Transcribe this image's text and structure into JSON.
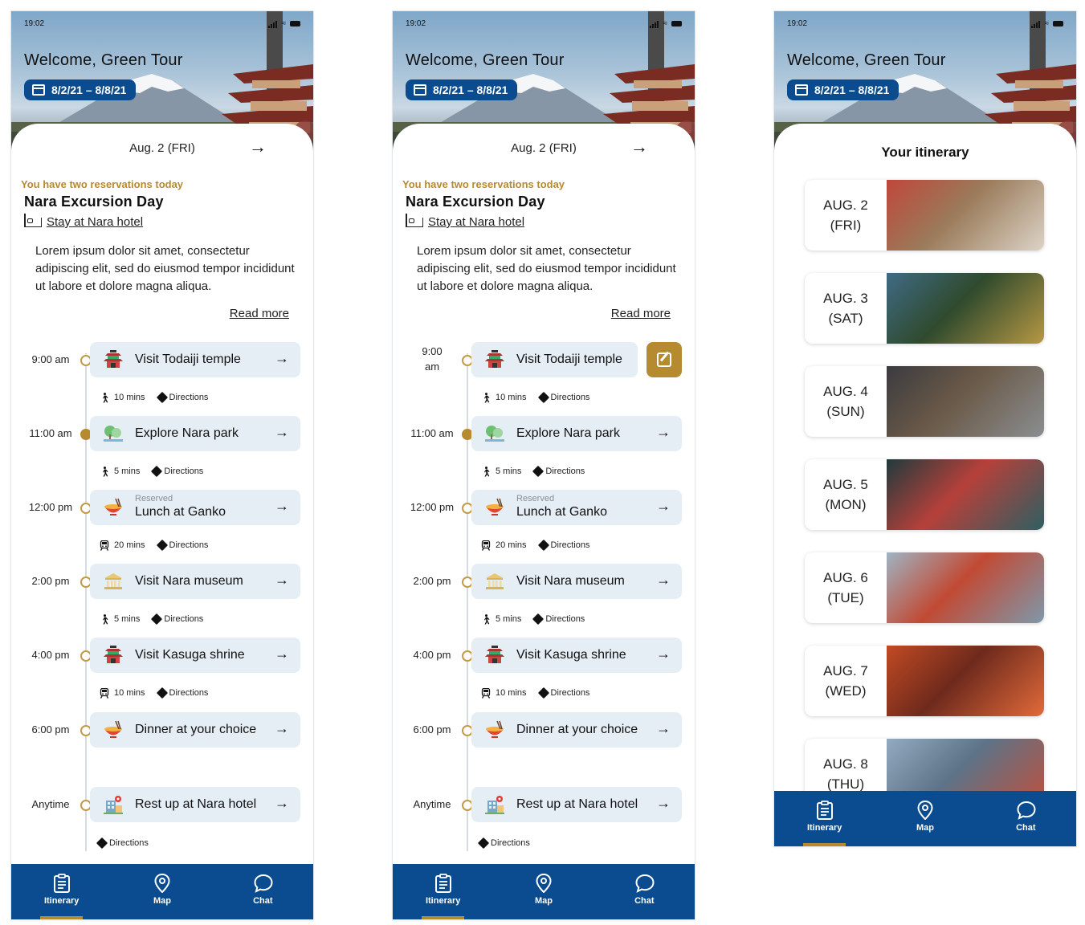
{
  "status": {
    "time": "19:02"
  },
  "header": {
    "welcome": "Welcome, Green Tour",
    "date_range": "8/2/21 – 8/8/21"
  },
  "day": {
    "label": "Aug. 2 (FRI)",
    "arrow": "→",
    "reservations_note": "You have two reservations today",
    "title": "Nara Excursion Day",
    "stay": "Stay at Nara hotel",
    "description": "Lorem ipsum dolor sit amet, consectetur adipiscing elit, sed do eiusmod tempor incididunt ut labore et dolore magna aliqua.",
    "read_more": "Read more"
  },
  "events": [
    {
      "time": "9:00 am",
      "time_alt": "9:00\nam",
      "label": "Visit Todaiji temple",
      "icon": "temple-icon",
      "current": false
    },
    {
      "time": "11:00 am",
      "label": "Explore Nara park",
      "icon": "park-icon",
      "current": true
    },
    {
      "time": "12:00 pm",
      "label": "Lunch at Ganko",
      "sublabel": "Reserved",
      "icon": "ramen-icon",
      "current": false
    },
    {
      "time": "2:00 pm",
      "label": "Visit Nara museum",
      "icon": "museum-icon",
      "current": false
    },
    {
      "time": "4:00 pm",
      "label": "Visit Kasuga shrine",
      "icon": "temple-icon",
      "current": false
    },
    {
      "time": "6:00 pm",
      "label": "Dinner at your choice",
      "icon": "ramen-icon",
      "current": false
    },
    {
      "time": "Anytime",
      "label": "Rest up at Nara hotel",
      "icon": "hotel-icon",
      "current": false
    }
  ],
  "travel": [
    {
      "mode": "walk-icon",
      "duration": "10 mins",
      "directions": "Directions"
    },
    {
      "mode": "walk-icon",
      "duration": "5 mins",
      "directions": "Directions"
    },
    {
      "mode": "train-icon",
      "duration": "20 mins",
      "directions": "Directions"
    },
    {
      "mode": "walk-icon",
      "duration": "5 mins",
      "directions": "Directions"
    },
    {
      "mode": "train-icon",
      "duration": "10 mins",
      "directions": "Directions"
    },
    {
      "mode": "none",
      "duration": "",
      "directions": ""
    },
    {
      "mode": "none",
      "duration": "",
      "directions": "Directions"
    }
  ],
  "tabs": [
    {
      "label": "Itinerary",
      "icon": "clipboard-icon",
      "active": true
    },
    {
      "label": "Map",
      "icon": "map-pin-icon",
      "active": false
    },
    {
      "label": "Chat",
      "icon": "chat-bubble-icon",
      "active": false
    }
  ],
  "itinerary": {
    "title": "Your itinerary",
    "days": [
      {
        "date": "AUG. 2",
        "weekday": "(FRI)",
        "photo": "autumn-shrine-photo",
        "colors": [
          "#c0473a",
          "#9a7b5a",
          "#dcd3c6"
        ]
      },
      {
        "date": "AUG. 3",
        "weekday": "(SAT)",
        "photo": "golden-pavilion-photo",
        "colors": [
          "#3f6b85",
          "#2f4a2d",
          "#b79844"
        ]
      },
      {
        "date": "AUG. 4",
        "weekday": "(SUN)",
        "photo": "old-street-photo",
        "colors": [
          "#3a3b3f",
          "#6b5a48",
          "#8a8e90"
        ]
      },
      {
        "date": "AUG. 5",
        "weekday": "(MON)",
        "photo": "night-alley-photo",
        "colors": [
          "#203a3c",
          "#b6403a",
          "#2e5f62"
        ]
      },
      {
        "date": "AUG. 6",
        "weekday": "(TUE)",
        "photo": "floating-torii-photo",
        "colors": [
          "#9fb4c3",
          "#c14a34",
          "#7f98aa"
        ]
      },
      {
        "date": "AUG. 7",
        "weekday": "(WED)",
        "photo": "torii-gates-photo",
        "colors": [
          "#c24a24",
          "#6e2a1c",
          "#e26a3a"
        ]
      },
      {
        "date": "AUG. 8",
        "weekday": "(THU)",
        "photo": "tokyo-tower-photo",
        "colors": [
          "#93aac0",
          "#5d7387",
          "#c1503c"
        ]
      }
    ]
  },
  "colors": {
    "brand_blue": "#0a4c8f",
    "accent_gold": "#b68a2e",
    "card_bg": "#e5edf5"
  }
}
